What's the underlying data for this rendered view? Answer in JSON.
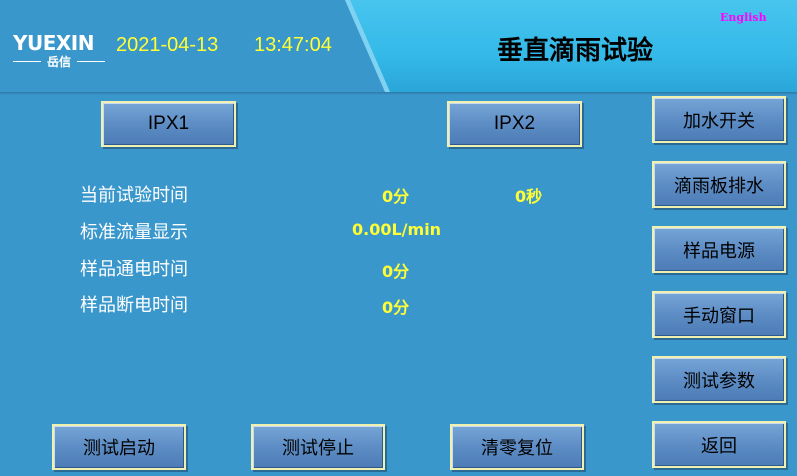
{
  "header": {
    "logo_text": "YUEXIN",
    "logo_sub": "岳信",
    "date": "2021-04-13",
    "time": "13:47:04",
    "title": "垂直滴雨试验",
    "language_link": "English"
  },
  "mode_buttons": {
    "ipx1": "IPX1",
    "ipx2": "IPX2"
  },
  "readouts": {
    "test_time_label": "当前试验时间",
    "test_time_minutes": "0分",
    "test_time_seconds": "0秒",
    "flow_label": "标准流量显示",
    "flow_value": "0.00L/min",
    "power_on_label": "样品通电时间",
    "power_on_value": "0分",
    "power_off_label": "样品断电时间",
    "power_off_value": "0分"
  },
  "side_menu": {
    "water_switch": "加水开关",
    "drip_plate_drain": "滴雨板排水",
    "sample_power": "样品电源",
    "manual_window": "手动窗口",
    "test_params": "测试参数",
    "back": "返回"
  },
  "bottom_buttons": {
    "start": "测试启动",
    "stop": "测试停止",
    "reset": "清零复位"
  },
  "colors": {
    "background": "#3a97cc",
    "header_right": "#3dbde9",
    "value_text": "#ffff35",
    "button_face": "#5f8fc6",
    "button_border": "#f0f0b0",
    "language_link": "#ff00ff"
  }
}
